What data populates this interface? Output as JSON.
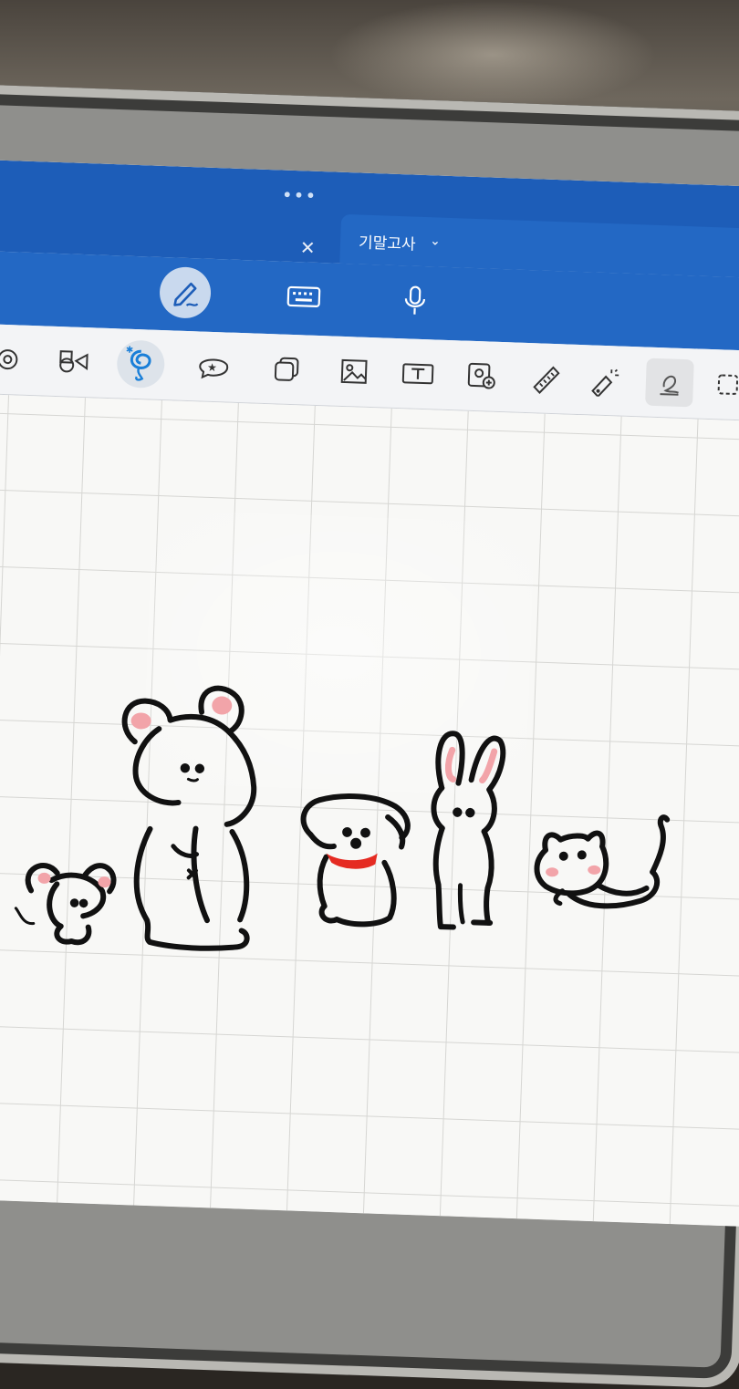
{
  "app": {
    "window_menu_icon": "more-dots-icon",
    "close_tab_icon": "close-icon",
    "active_tab": {
      "label": "기말고사",
      "chevron_icon": "chevron-down-icon"
    }
  },
  "input_modes": [
    {
      "name": "handwriting",
      "icon": "pencil-icon",
      "active": true
    },
    {
      "name": "keyboard",
      "icon": "keyboard-icon",
      "active": false
    },
    {
      "name": "voice",
      "icon": "microphone-icon",
      "active": false
    }
  ],
  "tools": [
    {
      "name": "lasso-partial",
      "icon": "target-icon"
    },
    {
      "name": "shapes",
      "icon": "shapes-icon"
    },
    {
      "name": "lasso",
      "icon": "lasso-icon",
      "selected": true
    },
    {
      "name": "sticker",
      "icon": "sticker-icon"
    },
    {
      "name": "elements",
      "icon": "stack-icon"
    },
    {
      "name": "image",
      "icon": "image-icon"
    },
    {
      "name": "text",
      "icon": "text-box-icon"
    },
    {
      "name": "camera",
      "icon": "camera-icon"
    },
    {
      "name": "ruler",
      "icon": "ruler-icon"
    },
    {
      "name": "laser-pointer",
      "icon": "laser-pointer-icon"
    },
    {
      "name": "eraser",
      "icon": "eraser-icon",
      "selected": true
    },
    {
      "name": "selection-box",
      "icon": "dashed-square-icon"
    }
  ],
  "colors": {
    "title_bar": "#1d5db8",
    "input_bar": "#2368c4",
    "accent": "#1a7fd8",
    "ink": "#111111",
    "blush": "#f2a4a9",
    "ribbon": "#e52b22"
  },
  "canvas": {
    "grid": true,
    "doodles": [
      "mouse",
      "bear",
      "puppy",
      "bunny",
      "cat"
    ]
  }
}
